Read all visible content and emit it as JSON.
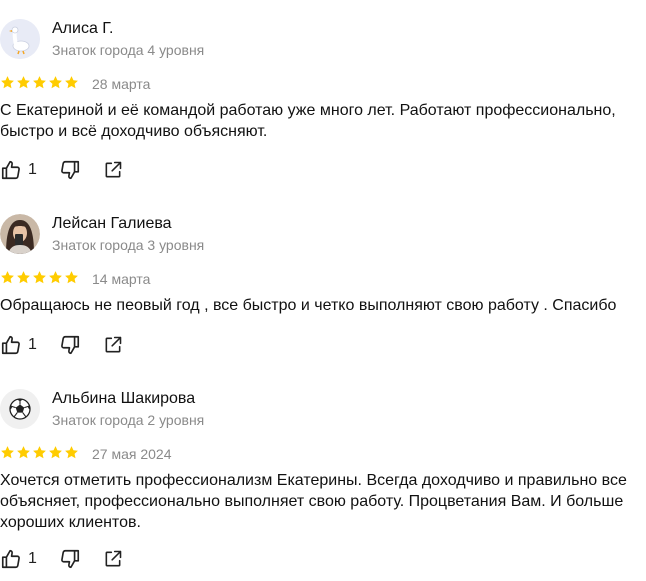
{
  "reviews": [
    {
      "name": "Алиса Г.",
      "level": "Знаток города 4 уровня",
      "avatar_icon": "goose-avatar-icon",
      "rating": 5,
      "date": "28 марта",
      "text": "С Екатериной и её командой работаю уже много лет. Работают профессионально, быстро и всё доходчиво объясняют.",
      "likes": "1"
    },
    {
      "name": "Лейсан Галиева",
      "level": "Знаток города 3 уровня",
      "avatar_icon": "user-photo-avatar",
      "rating": 5,
      "date": "14 марта",
      "text": "Обращаюсь не пеовый год , все быстро и четко выполняют свою работу . Спасибо",
      "likes": "1"
    },
    {
      "name": "Альбина Шакирова",
      "level": "Знаток города 2 уровня",
      "avatar_icon": "soccer-ball-avatar-icon",
      "rating": 5,
      "date": "27 мая 2024",
      "text": "Хочется отметить профессионализм Екатерины. Всегда доходчиво и правильно все объясняет, профессионально выполняет свою работу. Процветания Вам. И больше хороших клиентов.",
      "likes": "1"
    }
  ],
  "colors": {
    "star": "#fc0",
    "muted_text": "#8a8a8a",
    "icon": "#222222"
  }
}
